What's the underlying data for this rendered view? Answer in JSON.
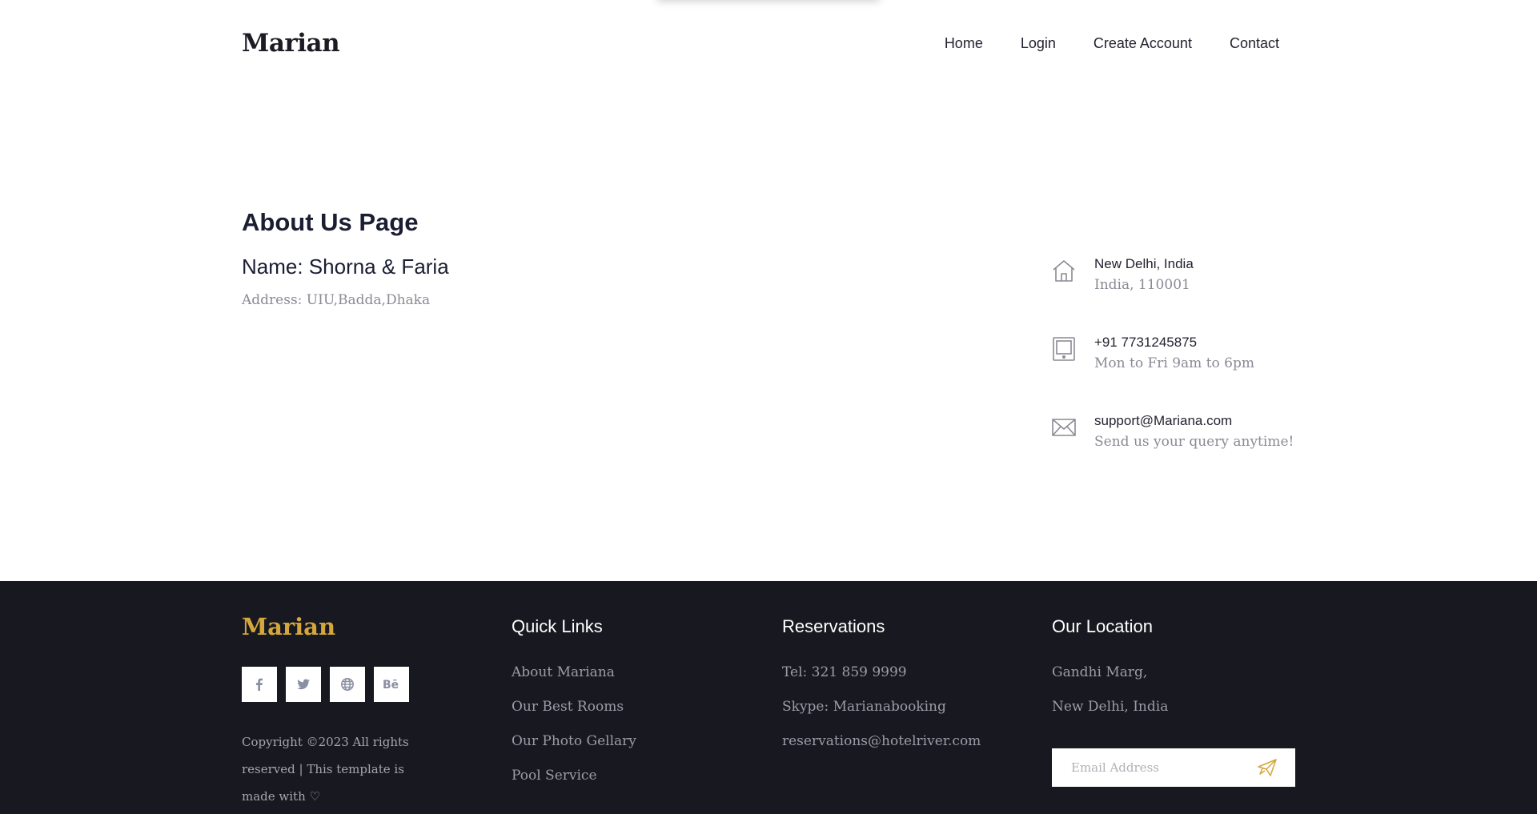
{
  "header": {
    "logo": "Marian",
    "nav": [
      {
        "label": "Home"
      },
      {
        "label": "Login"
      },
      {
        "label": "Create Account"
      },
      {
        "label": "Contact"
      }
    ]
  },
  "main": {
    "title": "About Us Page",
    "name": "Name: Shorna & Faria",
    "address": "Address: UIU,Badda,Dhaka"
  },
  "contact": [
    {
      "icon": "home-icon",
      "title": "New Delhi, India",
      "sub": "India, 110001"
    },
    {
      "icon": "tablet-icon",
      "title": "+91 7731245875",
      "sub": "Mon to Fri 9am to 6pm"
    },
    {
      "icon": "mail-icon",
      "title": "support@Mariana.com",
      "sub": "Send us your query anytime!"
    }
  ],
  "footer": {
    "logo": "Marian",
    "socials": [
      {
        "icon": "facebook-icon"
      },
      {
        "icon": "twitter-icon"
      },
      {
        "icon": "globe-icon"
      },
      {
        "icon": "behance-icon"
      }
    ],
    "copyright": "Copyright ©2023 All rights reserved | This template is made with ♡",
    "quick_links": {
      "title": "Quick Links",
      "items": [
        "About Mariana",
        "Our Best Rooms",
        "Our Photo Gellary",
        "Pool Service"
      ]
    },
    "reservations": {
      "title": "Reservations",
      "items": [
        "Tel: 321 859 9999",
        "Skype: Marianabooking",
        "reservations@hotelriver.com"
      ]
    },
    "location": {
      "title": "Our Location",
      "items": [
        "Gandhi Marg,",
        "New Delhi, India"
      ],
      "email_placeholder": "Email Address"
    }
  },
  "colors": {
    "accent": "#d4a63b",
    "footer_bg": "#181920",
    "muted_text": "#8a8a94"
  }
}
